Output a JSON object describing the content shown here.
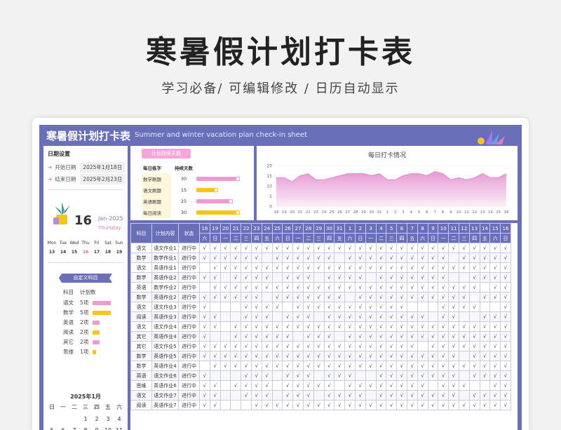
{
  "page": {
    "title": "寒暑假计划打卡表",
    "subtitle": "学习必备/  可编辑修改  / 日历自动显示"
  },
  "sheet": {
    "title": "寒暑假计划打卡表",
    "subtitle": "Summer and winter vacation plan check-in sheet"
  },
  "date_settings": {
    "heading": "日期设置",
    "start_label": "开始日期",
    "start_value": "2025年1月18日",
    "end_label": "结束日期",
    "end_value": "2025年2月23日"
  },
  "today": {
    "day": "16",
    "month": "Jan-2025",
    "weekday": "Thursday"
  },
  "week_strip": {
    "names": [
      "Mon",
      "Tue",
      "Wed",
      "Thu",
      "Fri",
      "Sat",
      "Sun"
    ],
    "days": [
      "13",
      "14",
      "15",
      "16",
      "17",
      "18",
      "19"
    ]
  },
  "custom_subjects": {
    "heading": "自定义科目",
    "col_subject": "科目",
    "col_count": "计划数",
    "items": [
      {
        "name": "语文",
        "count": "5项",
        "value": 5,
        "color": "#f29ad0"
      },
      {
        "name": "数学",
        "count": "5项",
        "value": 5,
        "color": "#f5c518"
      },
      {
        "name": "英语",
        "count": "2项",
        "value": 2,
        "color": "#f29ad0"
      },
      {
        "name": "阅读",
        "count": "2项",
        "value": 2,
        "color": "#f5c518"
      },
      {
        "name": "其它",
        "count": "2项",
        "value": 2,
        "color": "#f29ad0"
      },
      {
        "name": "思维",
        "count": "1项",
        "value": 1,
        "color": "#f5c518"
      }
    ]
  },
  "calendar": {
    "title": "2025年1月",
    "headers": [
      "日",
      "一",
      "二",
      "三",
      "四",
      "五",
      "六"
    ],
    "rows": [
      [
        "",
        "",
        "",
        "1",
        "2",
        "3",
        "4"
      ],
      [
        "5",
        "6",
        "7",
        "8",
        "9",
        "10",
        "11"
      ]
    ]
  },
  "plan_days": {
    "heading": "计划持续天数",
    "col_name": "每日练字",
    "col_days": "持续天数",
    "items": [
      {
        "name": "数学刷题",
        "days": "30",
        "value": 30,
        "color": "#f29ad0"
      },
      {
        "name": "语文刷题",
        "days": "15",
        "value": 15,
        "color": "#f5c518"
      },
      {
        "name": "英语刷题",
        "days": "25",
        "value": 25,
        "color": "#f29ad0"
      },
      {
        "name": "每日阅读",
        "days": "30",
        "value": 30,
        "color": "#f5c518"
      }
    ]
  },
  "chart_data": {
    "type": "area",
    "title": "每日打卡情况",
    "x": [
      "18",
      "19",
      "20",
      "21",
      "22",
      "23",
      "24",
      "25",
      "26",
      "27",
      "28",
      "29",
      "30",
      "31",
      "1",
      "2",
      "3",
      "4",
      "5",
      "6",
      "7",
      "8",
      "9",
      "10",
      "11",
      "12",
      "13",
      "14",
      "15",
      "16"
    ],
    "values": [
      14,
      14,
      12,
      15,
      16,
      13,
      13,
      14,
      15,
      16,
      16,
      16,
      15,
      16,
      13,
      13,
      15,
      16,
      16,
      15,
      17,
      16,
      13,
      14,
      13,
      14,
      16,
      14,
      14,
      16
    ],
    "ylim": [
      0,
      20
    ],
    "yticks": [
      0,
      5,
      10,
      15,
      20
    ],
    "color": "#e48fd0"
  },
  "table": {
    "headers": {
      "subject": "科目",
      "plan": "计划内容",
      "status": "状态"
    },
    "dates": [
      "18",
      "19",
      "20",
      "21",
      "22",
      "23",
      "24",
      "25",
      "26",
      "27",
      "28",
      "29",
      "30",
      "31",
      "1",
      "2",
      "3",
      "4",
      "5",
      "6",
      "7",
      "8",
      "9",
      "10",
      "11",
      "12",
      "13",
      "14",
      "15",
      "16"
    ],
    "weekdays": [
      "六",
      "日",
      "一",
      "二",
      "三",
      "四",
      "五",
      "六",
      "日",
      "一",
      "二",
      "三",
      "四",
      "五",
      "六",
      "日",
      "一",
      "二",
      "三",
      "四",
      "五",
      "六",
      "日",
      "一",
      "二",
      "三",
      "四",
      "五",
      "六",
      "日"
    ],
    "check_mark": "√",
    "rows": [
      {
        "subject": "语文",
        "plan": "语文作业1",
        "status": "进行中",
        "marks": "111111111111111111111111111111"
      },
      {
        "subject": "数学",
        "plan": "数学作业1",
        "status": "进行中",
        "marks": "111111011111101111111111011111"
      },
      {
        "subject": "语文",
        "plan": "英语作业1",
        "status": "进行中",
        "marks": "011111111111111111111111111111"
      },
      {
        "subject": "数学",
        "plan": "英语作业2",
        "status": "进行中",
        "marks": "110111101110111101111111001111"
      },
      {
        "subject": "英语",
        "plan": "数学作业2",
        "status": "进行中",
        "marks": "011111111111111111111111111011"
      },
      {
        "subject": "数学",
        "plan": "英语作业2",
        "status": "进行中",
        "marks": "111111011111110111111111110111"
      },
      {
        "subject": "语文",
        "plan": "语文作业3",
        "status": "进行中",
        "marks": "100011110111111111110001111001"
      },
      {
        "subject": "阅读",
        "plan": "英语作业3",
        "status": "进行中",
        "marks": "110011101110111111111101100111"
      },
      {
        "subject": "语文",
        "plan": "语文作业4",
        "status": "进行中",
        "marks": "110111111111111111111111111111"
      },
      {
        "subject": "其它",
        "plan": "英语作业4",
        "status": "进行中",
        "marks": "100111111011101111111111111111"
      },
      {
        "subject": "其它",
        "plan": "语文作业5",
        "status": "进行中",
        "marks": "111111111111111111111011111111"
      },
      {
        "subject": "数学",
        "plan": "英语作业5",
        "status": "进行中",
        "marks": "111111111111111111111111101111"
      },
      {
        "subject": "数学",
        "plan": "英语作业4",
        "status": "进行中",
        "marks": "011111111111111111111111111111"
      },
      {
        "subject": "英语",
        "plan": "语文作业6",
        "status": "进行中",
        "marks": "100011101110111001111111101111"
      },
      {
        "subject": "思维",
        "plan": "英语作业6",
        "status": "进行中",
        "marks": "110111101111101111111101110011"
      },
      {
        "subject": "语文",
        "plan": "语文作业7",
        "status": "进行中",
        "marks": "110011101110111101111111101111"
      },
      {
        "subject": "阅读",
        "plan": "英语作业7",
        "status": "进行中",
        "marks": "110001111111111111111111111111"
      }
    ]
  }
}
